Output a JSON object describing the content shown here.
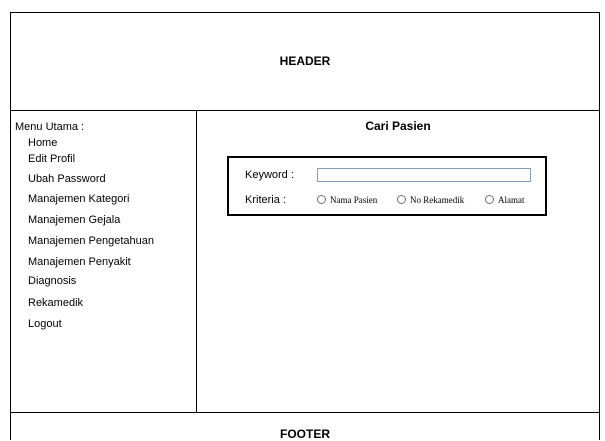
{
  "header": {
    "title": "HEADER"
  },
  "sidebar": {
    "heading": "Menu Utama :",
    "items": [
      {
        "label": "Home"
      },
      {
        "label": "Edit Profil"
      },
      {
        "label": "Ubah Password"
      },
      {
        "label": "Manajemen Kategori"
      },
      {
        "label": "Manajemen Gejala"
      },
      {
        "label": "Manajemen Pengetahuan"
      },
      {
        "label": "Manajemen Penyakit"
      },
      {
        "label": "Diagnosis"
      },
      {
        "label": "Rekamedik"
      },
      {
        "label": "Logout"
      }
    ]
  },
  "main": {
    "title": "Cari Pasien",
    "search": {
      "keyword_label": "Keyword :",
      "keyword_value": "",
      "criteria_label": "Kriteria :",
      "options": [
        {
          "label": "Nama Pasien"
        },
        {
          "label": "No Rekamedik"
        },
        {
          "label": "Alamat"
        }
      ]
    }
  },
  "footer": {
    "title": "FOOTER"
  }
}
